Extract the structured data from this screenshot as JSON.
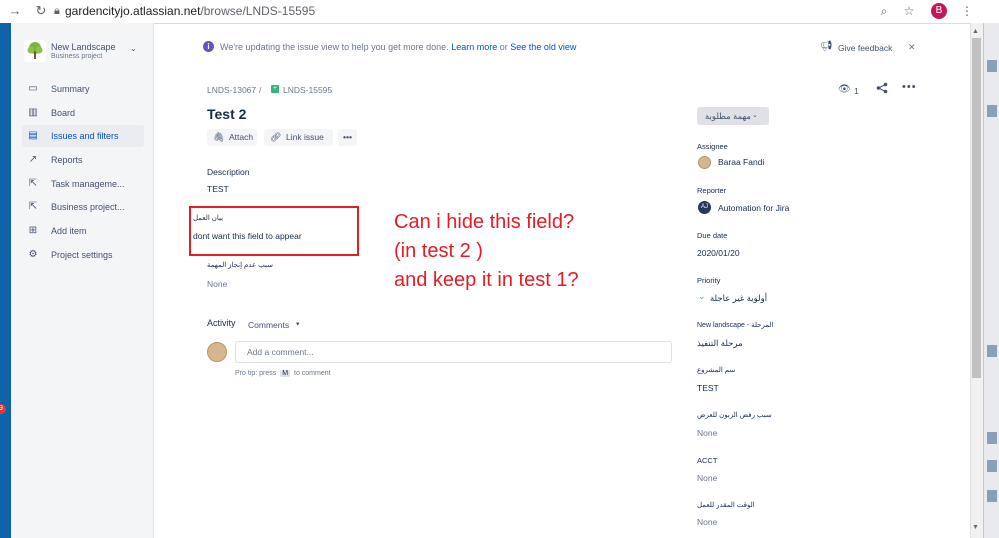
{
  "browser": {
    "url_domain": "gardencityjo.atlassian.net",
    "url_path": "/browse/LNDS-15595",
    "profile_initial": "B",
    "notification_count": "9"
  },
  "sidebar": {
    "project_name": "New Landscape",
    "project_type": "Business project",
    "items": [
      {
        "label": "Summary",
        "icon": "summary-icon"
      },
      {
        "label": "Board",
        "icon": "board-icon"
      },
      {
        "label": "Issues and filters",
        "icon": "issues-icon"
      },
      {
        "label": "Reports",
        "icon": "reports-icon"
      },
      {
        "label": "Task manageme...",
        "icon": "external-link-icon"
      },
      {
        "label": "Business project...",
        "icon": "external-link-icon"
      },
      {
        "label": "Add item",
        "icon": "add-item-icon"
      },
      {
        "label": "Project settings",
        "icon": "gear-icon"
      }
    ],
    "active_index": 2
  },
  "banner": {
    "text": "We're updating the issue view to help you get more done.",
    "learn_more": "Learn more",
    "or": "or",
    "old_view": "See the old view",
    "feedback": "Give feedback"
  },
  "breadcrumb": {
    "parent": "LNDS-13067",
    "separator": "/",
    "current": "LNDS-15595"
  },
  "watchers": "1",
  "issue": {
    "title": "Test 2",
    "attach": "Attach",
    "link": "Link issue",
    "more": "•••"
  },
  "fields": {
    "description_label": "Description",
    "description_value": "TEST",
    "work_label": "بيان العمل",
    "work_value": "dont want this field to appear",
    "reason_label": "سبب عدم إنجاز المهمة",
    "reason_value": "None"
  },
  "annotation": {
    "line1": "Can i hide this field?",
    "line2": "(in test 2 )",
    "line3": "and keep it in test 1?"
  },
  "activity": {
    "label": "Activity",
    "filter": "Comments",
    "placeholder": "Add a comment...",
    "protip_pre": "Pro tip: press",
    "protip_key": "M",
    "protip_post": "to comment"
  },
  "right_panel": {
    "status": "مهمة مطلوبة",
    "assignee_label": "Assignee",
    "assignee": "Baraa Fandi",
    "reporter_label": "Reporter",
    "reporter": "Automation for Jira",
    "reporter_initials": "AJ",
    "due_label": "Due date",
    "due": "2020/01/20",
    "priority_label": "Priority",
    "priority": "أولوية غير عاجلة",
    "stage_label": "New landscape - المرحلة",
    "stage": "مرحلة التنفيذ",
    "project_label": "سم المشروع",
    "project": "TEST",
    "delay_label": "سبب رفض الزبون للعرض",
    "delay": "None",
    "acct_label": "ACCT",
    "acct": "None",
    "time_label": "الوقت المقدر للعمل",
    "time": "None"
  },
  "colors": {
    "accent": "#0052cc",
    "annotation": "#e51c23",
    "left_strip": "#0f63a8"
  }
}
